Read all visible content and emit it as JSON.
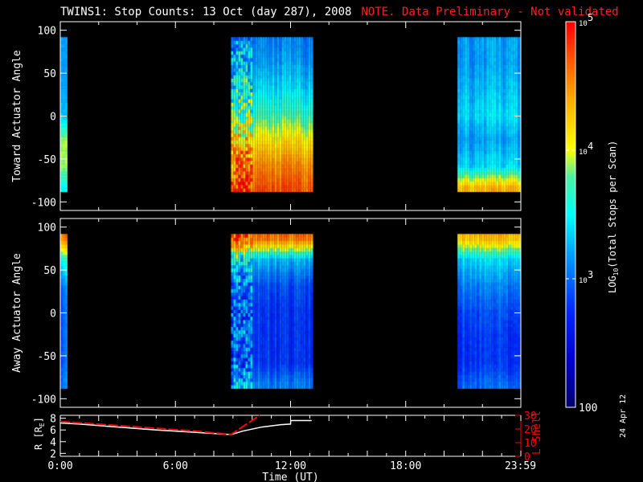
{
  "title": {
    "main": "TWINS1: Stop Counts: 13 Oct (day 287), 2008",
    "note": "NOTE. Data Preliminary - Not validated",
    "note_color": "#ff2020"
  },
  "stamp": "24 Apr 12",
  "chart_data": [
    {
      "type": "heatmap",
      "name": "toward",
      "ylabel": "Toward Actuator Angle",
      "ylim": [
        -110,
        110
      ],
      "yticks": [
        "100",
        "50",
        "0",
        "-50",
        "-100"
      ],
      "yticks_values": [
        100,
        50,
        0,
        -50,
        -100
      ],
      "xlim_hours": [
        0,
        24
      ],
      "data_intervals_hours": [
        [
          0.0,
          0.35
        ],
        [
          8.9,
          13.1
        ],
        [
          20.7,
          24.0
        ]
      ],
      "angle_range": [
        -88,
        90
      ],
      "angles": [
        -85,
        -60,
        -30,
        0,
        30,
        60,
        85
      ],
      "log10_counts_by_interval": [
        [
          3.5,
          3.9,
          3.9,
          3.3,
          3.2,
          3.2,
          3.2
        ],
        [
          4.7,
          4.5,
          4.1,
          3.7,
          3.4,
          3.2,
          3.1
        ],
        [
          4.3,
          3.4,
          3.2,
          3.4,
          3.3,
          3.2,
          3.2
        ]
      ]
    },
    {
      "type": "heatmap",
      "name": "away",
      "ylabel": "Away Actuator Angle",
      "ylim": [
        -110,
        110
      ],
      "yticks": [
        "100",
        "50",
        "0",
        "-50",
        "-100"
      ],
      "yticks_values": [
        100,
        50,
        0,
        -50,
        -100
      ],
      "xlim_hours": [
        0,
        24
      ],
      "data_intervals_hours": [
        [
          0.0,
          0.35
        ],
        [
          8.9,
          13.1
        ],
        [
          20.7,
          24.0
        ]
      ],
      "angle_range": [
        -88,
        90
      ],
      "angles": [
        -85,
        -60,
        -30,
        0,
        30,
        60,
        85
      ],
      "log10_counts_by_interval": [
        [
          3.1,
          3.0,
          3.0,
          3.0,
          3.1,
          3.6,
          4.6
        ],
        [
          3.1,
          2.8,
          2.8,
          2.8,
          2.9,
          3.3,
          4.6
        ],
        [
          3.0,
          2.8,
          2.8,
          2.9,
          3.1,
          3.4,
          4.3
        ]
      ]
    },
    {
      "type": "colorbar",
      "label": "LOG10(Total Stops per Scan)",
      "label_main": "LOG",
      "label_sub": "10",
      "label_rest": "(Total Stops per Scan)",
      "ticks": [
        {
          "base": "10",
          "exp": "5",
          "value": 100000
        },
        {
          "base": "10",
          "exp": "4",
          "value": 10000
        },
        {
          "base": "10",
          "exp": "3",
          "value": 1000
        },
        {
          "base": "100",
          "exp": "",
          "value": 100
        }
      ],
      "range": [
        100,
        100000
      ]
    },
    {
      "type": "line",
      "name": "ephemeris",
      "ylabel_left": "R [R",
      "ylabel_left_sub": "E",
      "ylabel_left_end": "]",
      "ylabel_right": "L Shell",
      "ylim_left": [
        1.5,
        8.5
      ],
      "ylim_right": [
        0,
        30
      ],
      "yticks_left": [
        "8",
        "6",
        "4",
        "2"
      ],
      "yticks_right": [
        "30",
        "20",
        "10",
        "0"
      ],
      "xlabel": "Time (UT)",
      "xticks": [
        "0:00",
        "6:00",
        "12:00",
        "18:00",
        "23:59"
      ],
      "xticks_hours": [
        0,
        6,
        12,
        18,
        23.98
      ],
      "series": [
        {
          "name": "R",
          "color": "#ffffff",
          "x": [
            0,
            1,
            3,
            5,
            7,
            8.9,
            9.5,
            10.5,
            11.5,
            12,
            12.01,
            13.1
          ],
          "y": [
            7.2,
            7.0,
            6.5,
            6.0,
            5.6,
            5.2,
            5.8,
            6.5,
            6.9,
            7.0,
            7.6,
            7.6
          ]
        },
        {
          "name": "L Shell",
          "color": "#ff0000",
          "x": [
            0,
            1,
            3,
            5,
            7,
            8.9,
            10.4
          ],
          "y": [
            25.5,
            24.5,
            22.5,
            20.5,
            18.5,
            16.0,
            30
          ]
        }
      ]
    }
  ]
}
